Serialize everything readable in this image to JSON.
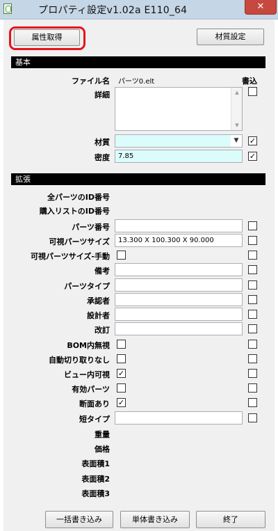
{
  "window": {
    "title": "プロパティ設定v1.02a E110_64",
    "close_glyph": "✕"
  },
  "toolbar": {
    "get_attributes_label": "属性取得",
    "material_settings_label": "材質設定"
  },
  "basic": {
    "header": "基本",
    "write_column_label": "書込",
    "file_name_label": "ファイル名",
    "file_name_value": "パーツ0.elt",
    "detail_label": "詳細",
    "material_label": "材質",
    "material_value": "",
    "material_checked": true,
    "density_label": "密度",
    "density_value": "7.85",
    "density_checked": true
  },
  "extended": {
    "header": "拡張",
    "all_parts_id_label": "全パーツのID番号",
    "purchase_list_id_label": "購入リストのID番号",
    "part_number_label": "パーツ番号",
    "part_number_value": "",
    "visible_size_label": "可視パーツサイズ",
    "visible_size_value": "13.300 X 100.300 X 90.000",
    "visible_size_manual_label": "可視パーツサイズ-手動",
    "remarks_label": "備考",
    "part_type_label": "パーツタイプ",
    "approver_label": "承認者",
    "designer_label": "設計者",
    "revision_label": "改訂",
    "bom_ignore_label": "BOM内無視",
    "no_auto_cut_label": "自動切り取りなし",
    "view_visible_label": "ビュー内可視",
    "valid_part_label": "有効パーツ",
    "has_section_label": "断面あり",
    "short_type_label": "短タイプ",
    "weight_label": "重量",
    "price_label": "価格",
    "surface_area1_label": "表面積1",
    "surface_area2_label": "表面積2",
    "surface_area3_label": "表面積3",
    "view_visible_checked": true,
    "has_section_checked": true
  },
  "footer": {
    "batch_write_label": "一括書き込み",
    "single_write_label": "単体書き込み",
    "finish_label": "終了"
  },
  "colors": {
    "highlight": "#e6121b",
    "input_cyan": "#dcfcfc",
    "section_header": "#000000",
    "title_bar": "#c5d6e6",
    "close_button": "#c7483e"
  }
}
